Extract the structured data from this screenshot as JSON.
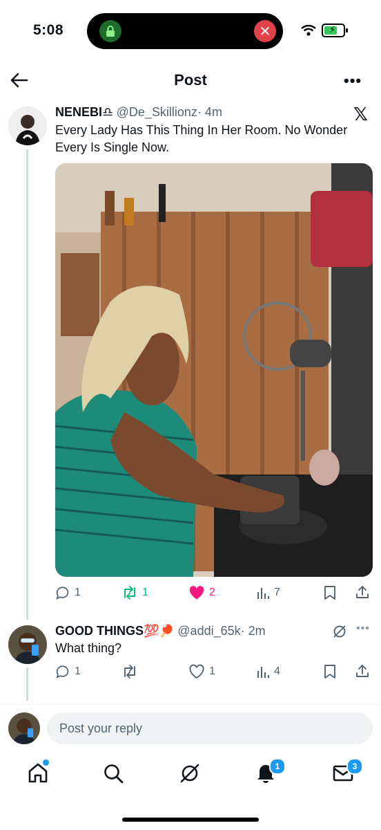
{
  "status_bar": {
    "time": "5:08"
  },
  "header": {
    "title": "Post"
  },
  "tweet": {
    "name": "NENEBI♎",
    "handle": "@De_Skillionz",
    "time": "· 4m",
    "text": "Every Lady Has This Thing In Her Room. No Wonder Every Is Single Now.",
    "stats": {
      "replies": "1",
      "reposts": "1",
      "likes": "2",
      "views": "7"
    },
    "colors": {
      "repost": "#00ba7c",
      "like": "#f91880"
    }
  },
  "reply": {
    "name": "GOOD THINGS💯🏓",
    "handle": "@addi_65k",
    "time": "· 2m",
    "text": "What thing?",
    "stats": {
      "replies": "1",
      "likes": "1",
      "views": "4"
    }
  },
  "composer": {
    "placeholder": "Post your reply"
  },
  "tab_bar": {
    "notifications_badge": "1",
    "messages_badge": "3"
  }
}
